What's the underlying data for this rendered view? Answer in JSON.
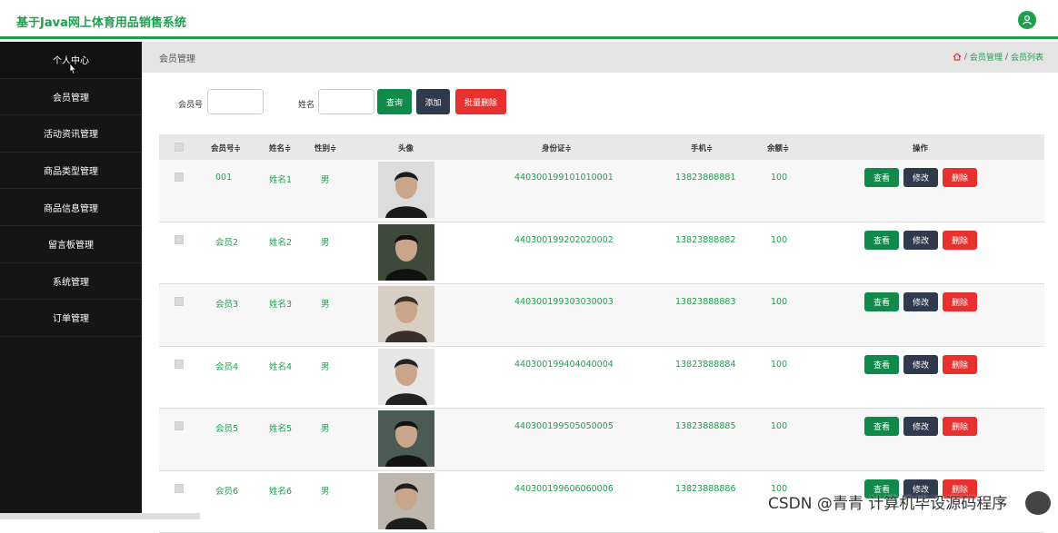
{
  "app": {
    "title": "基于Java网上体育用品销售系统"
  },
  "sidebar": {
    "items": [
      {
        "label": "个人中心"
      },
      {
        "label": "会员管理"
      },
      {
        "label": "活动资讯管理"
      },
      {
        "label": "商品类型管理"
      },
      {
        "label": "商品信息管理"
      },
      {
        "label": "留言板管理"
      },
      {
        "label": "系统管理"
      },
      {
        "label": "订单管理"
      }
    ]
  },
  "header": {
    "title": "会员管理",
    "breadcrumb": [
      "会员管理",
      "会员列表"
    ]
  },
  "search": {
    "member_label": "会员号",
    "name_label": "姓名",
    "query_btn": "查询",
    "add_btn": "添加",
    "batch_delete_btn": "批量删除"
  },
  "table": {
    "headers": {
      "member": "会员号≑",
      "name": "姓名≑",
      "gender": "性别≑",
      "avatar": "头像",
      "idcard": "身份证≑",
      "phone": "手机≑",
      "balance": "余额≑",
      "actions": "操作"
    },
    "action_labels": {
      "view": "查看",
      "edit": "修改",
      "delete": "删除"
    },
    "rows": [
      {
        "member": "001",
        "name": "姓名1",
        "gender": "男",
        "idcard": "440300199101010001",
        "phone": "13823888881",
        "balance": "100"
      },
      {
        "member": "会员2",
        "name": "姓名2",
        "gender": "男",
        "idcard": "440300199202020002",
        "phone": "13823888882",
        "balance": "100"
      },
      {
        "member": "会员3",
        "name": "姓名3",
        "gender": "男",
        "idcard": "440300199303030003",
        "phone": "13823888883",
        "balance": "100"
      },
      {
        "member": "会员4",
        "name": "姓名4",
        "gender": "男",
        "idcard": "440300199404040004",
        "phone": "13823888884",
        "balance": "100"
      },
      {
        "member": "会员5",
        "name": "姓名5",
        "gender": "男",
        "idcard": "440300199505050005",
        "phone": "13823888885",
        "balance": "100"
      },
      {
        "member": "会员6",
        "name": "姓名6",
        "gender": "男",
        "idcard": "440300199606060006",
        "phone": "13823888886",
        "balance": "100"
      }
    ]
  },
  "watermark": {
    "text": "CSDN @青青  计算机毕设源码程序"
  },
  "colors": {
    "accent": "#1e9f4d",
    "sidebar": "#151515",
    "danger": "#e8312f",
    "navy": "#2f3a4d"
  }
}
